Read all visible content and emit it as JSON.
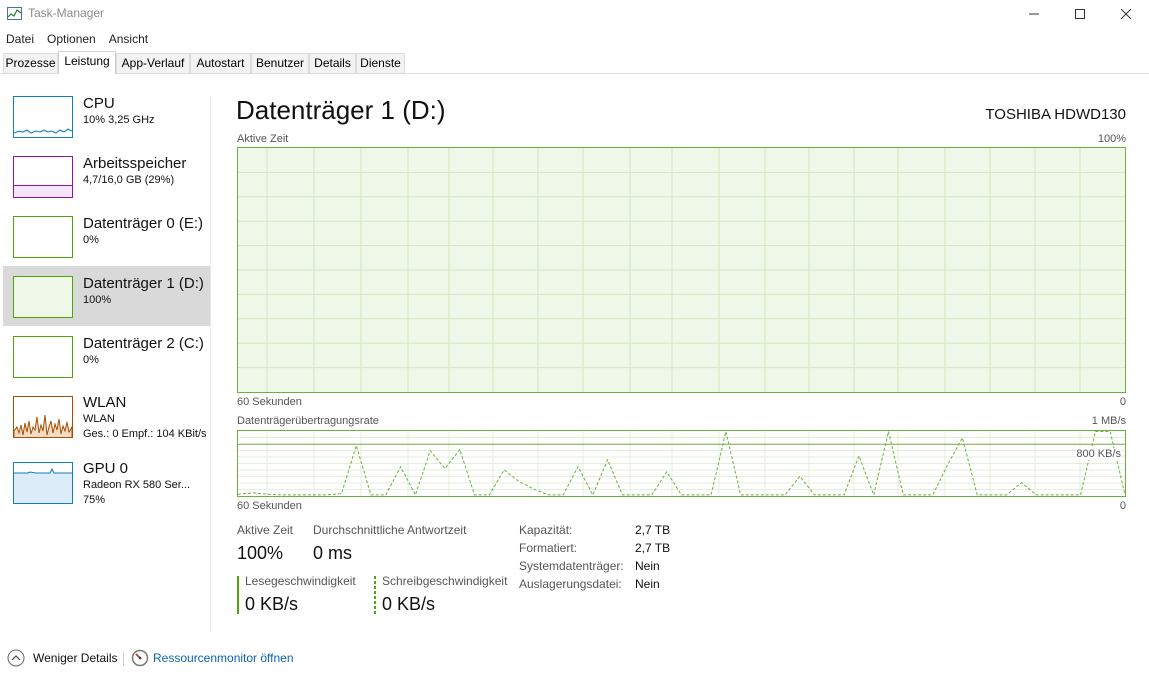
{
  "window": {
    "title": "Task-Manager",
    "minimize_icon": "minimize-icon",
    "maximize_icon": "maximize-icon",
    "close_icon": "close-icon"
  },
  "menu": [
    "Datei",
    "Optionen",
    "Ansicht"
  ],
  "tabs": [
    {
      "label": "Prozesse"
    },
    {
      "label": "Leistung",
      "active": true
    },
    {
      "label": "App-Verlauf"
    },
    {
      "label": "Autostart"
    },
    {
      "label": "Benutzer"
    },
    {
      "label": "Details"
    },
    {
      "label": "Dienste"
    }
  ],
  "sidebar": {
    "items": [
      {
        "name": "CPU",
        "sub1": "10%  3,25 GHz",
        "color": "#117dbb"
      },
      {
        "name": "Arbeitsspeicher",
        "sub1": "4,7/16,0 GB (29%)",
        "color": "#8b12ae",
        "level": 0.29
      },
      {
        "name": "Datenträger 0 (E:)",
        "sub1": "0%",
        "color": "#4da60c"
      },
      {
        "name": "Datenträger 1 (D:)",
        "sub1": "100%",
        "color": "#4da60c",
        "selected": true
      },
      {
        "name": "Datenträger 2 (C:)",
        "sub1": "0%",
        "color": "#4da60c"
      },
      {
        "name": "WLAN",
        "sub1": "WLAN",
        "sub2": "Ges.: 0  Empf.: 104 KBit/s",
        "color": "#a74f01"
      },
      {
        "name": "GPU 0",
        "sub1": "Radeon RX 580 Ser...",
        "sub2": "75%",
        "color": "#117dbb"
      }
    ]
  },
  "main": {
    "title": "Datenträger 1 (D:)",
    "model": "TOSHIBA HDWD130",
    "chart1": {
      "label": "Aktive Zeit",
      "max": "100%",
      "time": "60 Sekunden",
      "min": "0",
      "value_pct": 100
    },
    "chart2": {
      "label": "Datenträgerübertragungsrate",
      "max": "1 MB/s",
      "mid": "800 KB/s",
      "time": "60 Sekunden",
      "min": "0"
    },
    "stats": {
      "active_label": "Aktive Zeit",
      "active_value": "100%",
      "resp_label": "Durchschnittliche Antwortzeit",
      "resp_value": "0 ms",
      "read_label": "Lesegeschwindigkeit",
      "read_value": "0 KB/s",
      "write_label": "Schreibgeschwindigkeit",
      "write_value": "0 KB/s"
    },
    "props": [
      {
        "label": "Kapazität:",
        "value": "2,7 TB"
      },
      {
        "label": "Formatiert:",
        "value": "2,7 TB"
      },
      {
        "label": "Systemdatenträger:",
        "value": "Nein"
      },
      {
        "label": "Auslagerungsdatei:",
        "value": "Nein"
      }
    ]
  },
  "chart_data": {
    "type": "line",
    "title": "Datenträgerübertragungsrate",
    "xlabel": "60 Sekunden",
    "ylabel": "",
    "ylim": [
      0,
      1000
    ],
    "y_unit": "KB/s",
    "x": [
      0,
      1,
      2,
      3,
      4,
      5,
      6,
      7,
      8,
      9,
      10,
      11,
      12,
      13,
      14,
      15,
      16,
      17,
      18,
      19,
      20,
      21,
      22,
      23,
      24,
      25,
      26,
      27,
      28,
      29,
      30,
      31,
      32,
      33,
      34,
      35,
      36,
      37,
      38,
      39,
      40,
      41,
      42,
      43,
      44,
      45,
      46,
      47,
      48,
      49,
      50,
      51,
      52,
      53,
      54,
      55,
      56,
      57,
      58,
      59,
      60
    ],
    "series": [
      {
        "values": [
          20,
          40,
          20,
          10,
          10,
          10,
          10,
          30,
          780,
          10,
          10,
          450,
          10,
          700,
          420,
          720,
          10,
          10,
          400,
          220,
          100,
          10,
          10,
          450,
          10,
          560,
          10,
          10,
          10,
          370,
          10,
          10,
          10,
          1000,
          10,
          10,
          10,
          10,
          300,
          10,
          10,
          10,
          620,
          10,
          1000,
          10,
          10,
          10,
          480,
          900,
          10,
          10,
          10,
          200,
          10,
          10,
          10,
          10,
          1000,
          1000,
          10
        ]
      }
    ]
  },
  "footer": {
    "less_details": "Weniger Details",
    "resource_monitor": "Ressourcenmonitor öffnen",
    "chevron_icon": "chevron-up-icon",
    "monitor_icon": "resource-monitor-icon"
  }
}
